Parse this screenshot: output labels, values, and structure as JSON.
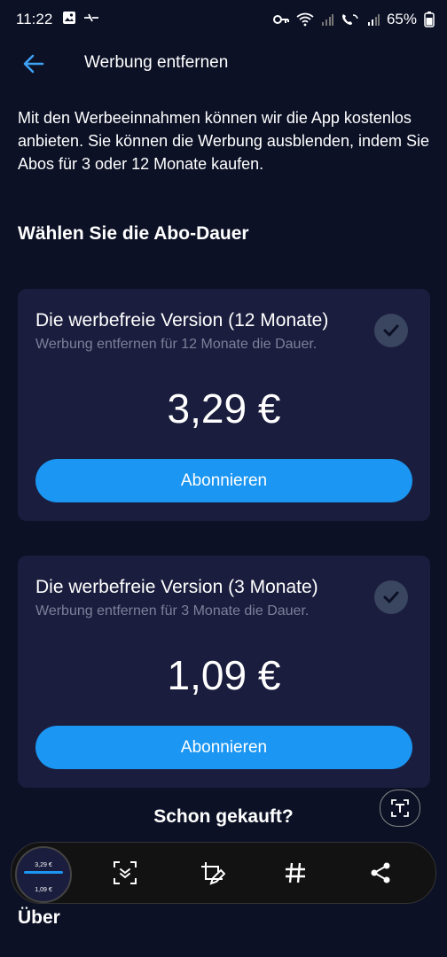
{
  "status_bar": {
    "time": "11:22",
    "battery": "65%"
  },
  "app_bar": {
    "title": "Werbung entfernen"
  },
  "intro_text": "Mit den Werbeeinnahmen können wir die App kostenlos anbieten. Sie können die Werbung ausblenden, indem Sie Abos für 3 oder 12 Monate kaufen.",
  "section_title": "Wählen Sie die Abo-Dauer",
  "plans": [
    {
      "title": "Die werbefreie Version (12 Monate)",
      "subtitle": "Werbung entfernen für 12 Monate die Dauer.",
      "price": "3,29 €",
      "button": "Abonnieren"
    },
    {
      "title": "Die werbefreie Version (3 Monate)",
      "subtitle": "Werbung entfernen für 3 Monate die Dauer.",
      "price": "1,09 €",
      "button": "Abonnieren"
    }
  ],
  "already_purchased": "Schon gekauft?",
  "about": "Über",
  "thumbnail": {
    "price1": "3,29 €",
    "price2": "1,09 €"
  },
  "colors": {
    "background": "#0c1126",
    "card": "#1a1d3d",
    "accent": "#1b96f2"
  }
}
